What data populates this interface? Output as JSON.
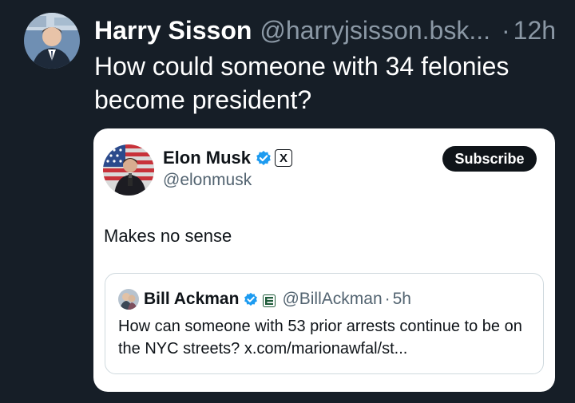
{
  "post": {
    "author_name": "Harry Sisson",
    "author_handle": "@harryjsisson.bsk...",
    "separator": "·",
    "time": "12h",
    "text": "How could someone with 34 felonies become president?"
  },
  "embed": {
    "author_name": "Elon Musk",
    "author_handle": "@elonmusk",
    "subscribe_label": "Subscribe",
    "text": "Makes no sense",
    "affiliate_badge": "X",
    "quote": {
      "author_name": "Bill Ackman",
      "author_handle": "@BillAckman",
      "separator": "·",
      "time": "5h",
      "text": "How can someone with 53 prior arrests continue to be on the NYC streets? x.com/marionawfal/st..."
    }
  },
  "colors": {
    "background": "#161e27",
    "verified_blue": "#1d9bf0",
    "card_bg": "#ffffff",
    "muted_text": "#536471",
    "outer_muted": "#8b98a5"
  }
}
